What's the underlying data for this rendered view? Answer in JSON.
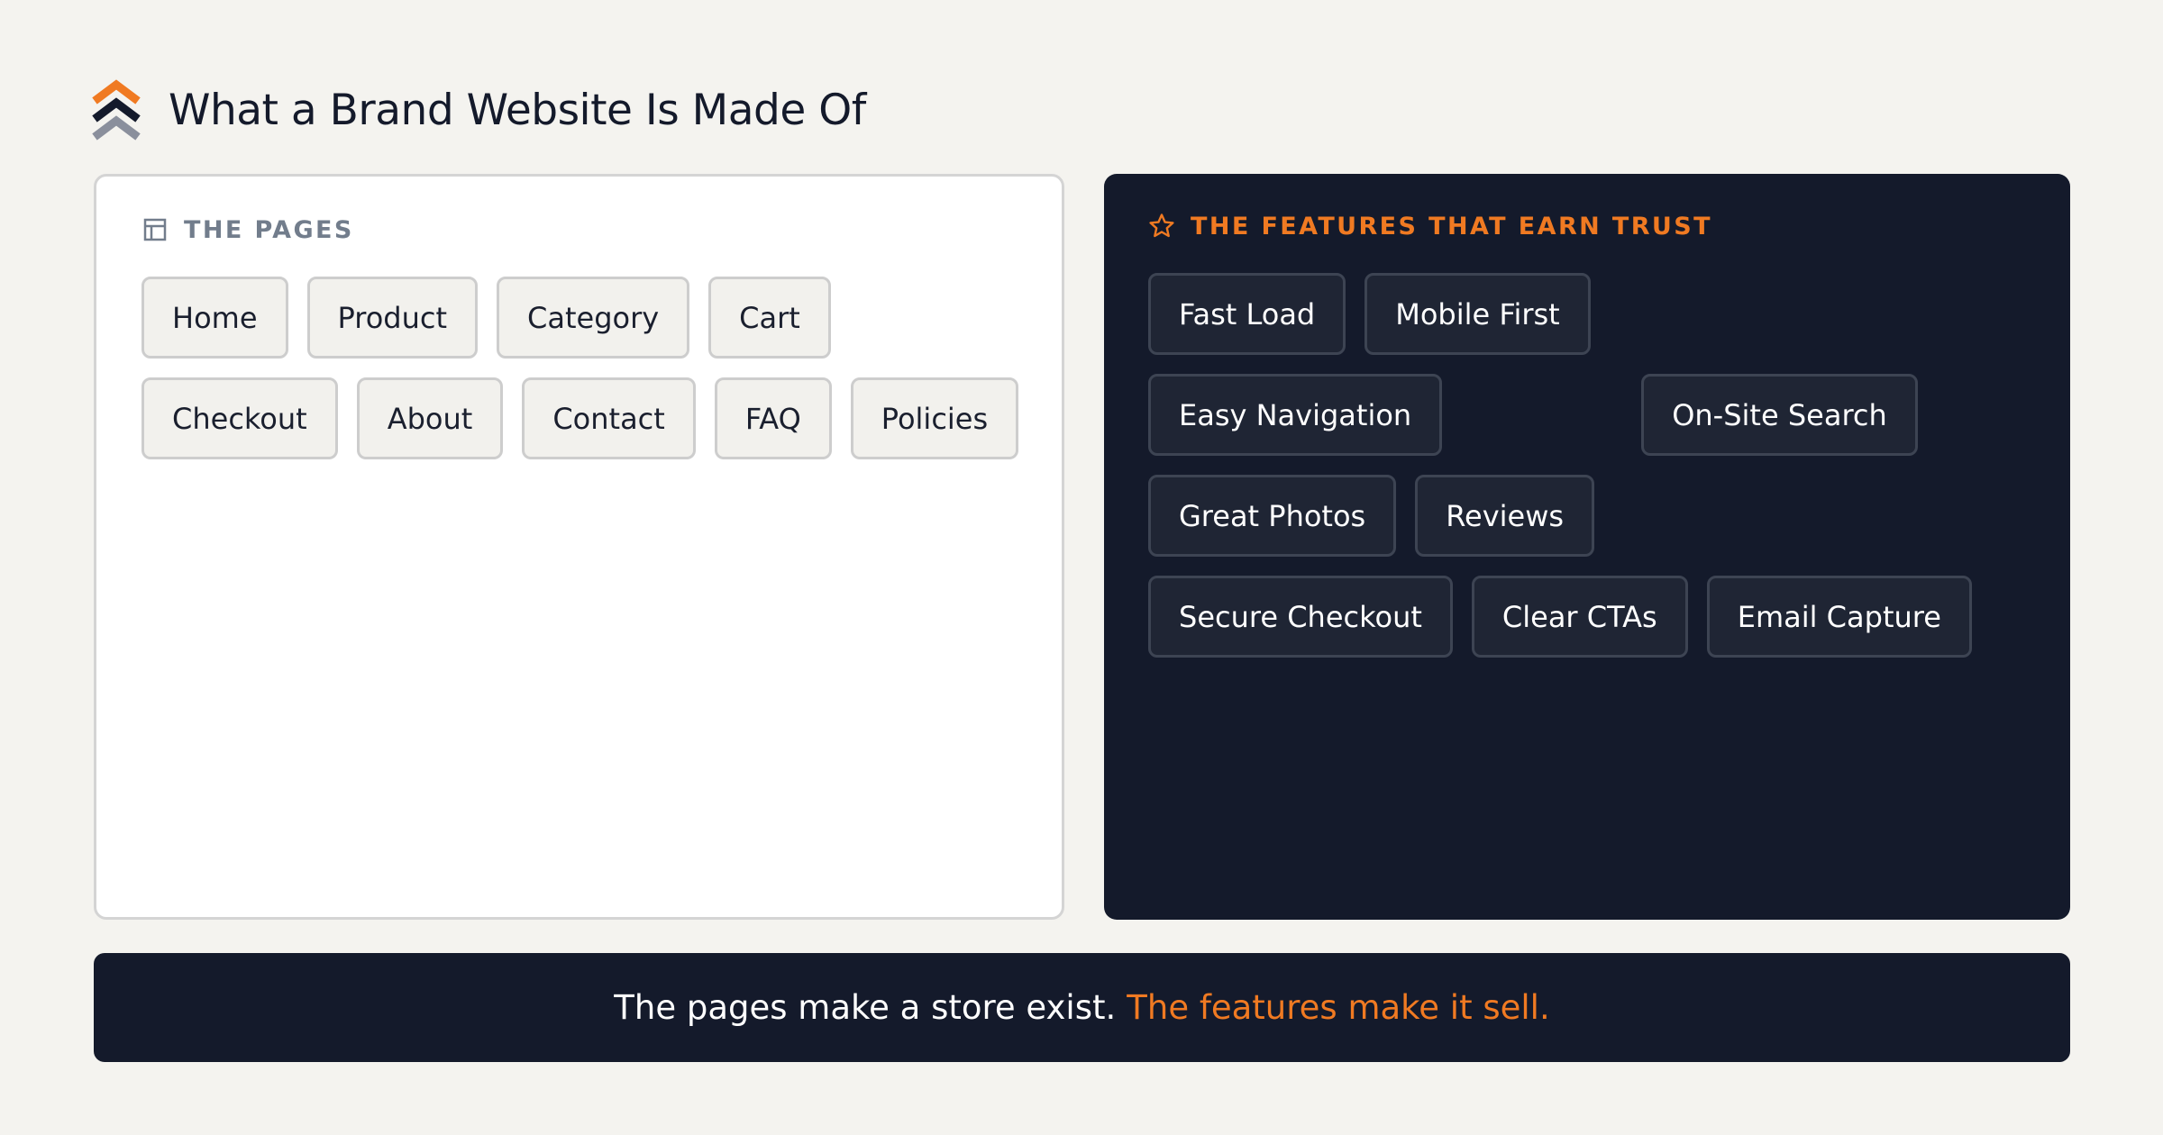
{
  "header": {
    "title": "What a Brand Website Is Made Of",
    "logo_icon": "stacked-chevrons-icon"
  },
  "pages_panel": {
    "heading": "THE PAGES",
    "icon": "layout-icon",
    "items": [
      "Home",
      "Product",
      "Category",
      "Cart",
      "Checkout",
      "About",
      "Contact",
      "FAQ",
      "Policies"
    ]
  },
  "features_panel": {
    "heading": "THE FEATURES THAT EARN TRUST",
    "icon": "star-icon",
    "items": [
      "Fast Load",
      "Mobile First",
      "Easy Navigation",
      "On-Site Search",
      "Great Photos",
      "Reviews",
      "Secure Checkout",
      "Clear CTAs",
      "Email Capture"
    ]
  },
  "footer": {
    "lead": "The pages make a store exist.",
    "accent": "The features make it sell."
  },
  "colors": {
    "background": "#f4f3ef",
    "navy": "#141a2b",
    "accent": "#f07a22",
    "muted": "#727d8c"
  }
}
